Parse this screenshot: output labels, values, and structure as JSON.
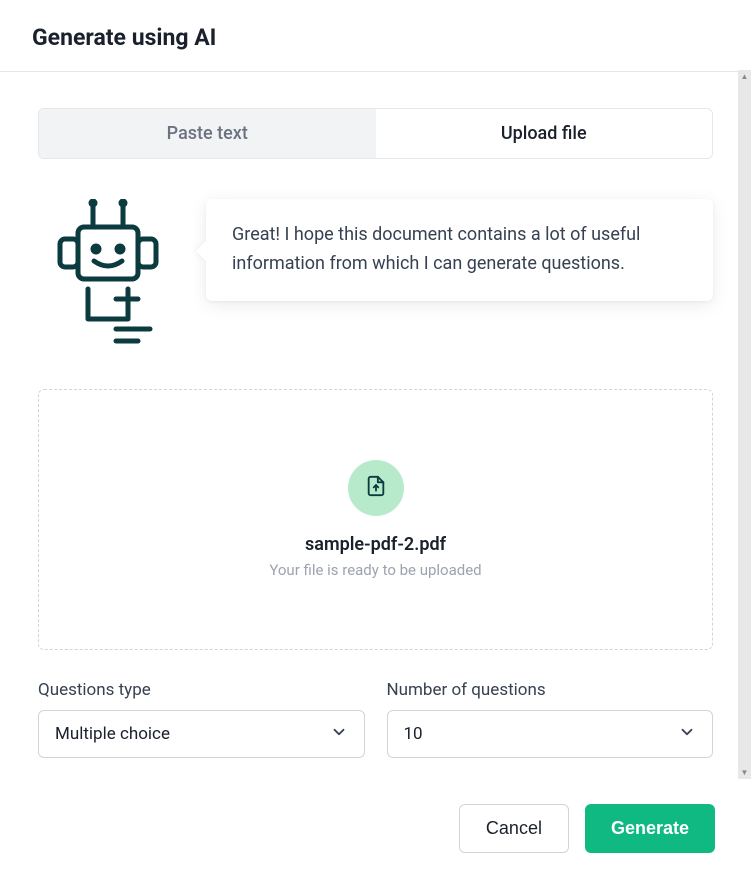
{
  "header": {
    "title": "Generate using AI"
  },
  "tabs": {
    "paste_text": "Paste text",
    "upload_file": "Upload file"
  },
  "bot_message": "Great! I hope this document contains a lot of useful information from which I can generate questions.",
  "upload": {
    "file_name": "sample-pdf-2.pdf",
    "status": "Your file is ready to be uploaded"
  },
  "form": {
    "questions_type_label": "Questions type",
    "questions_type_value": "Multiple choice",
    "num_questions_label": "Number of questions",
    "num_questions_value": "10"
  },
  "footer": {
    "cancel": "Cancel",
    "generate": "Generate"
  }
}
